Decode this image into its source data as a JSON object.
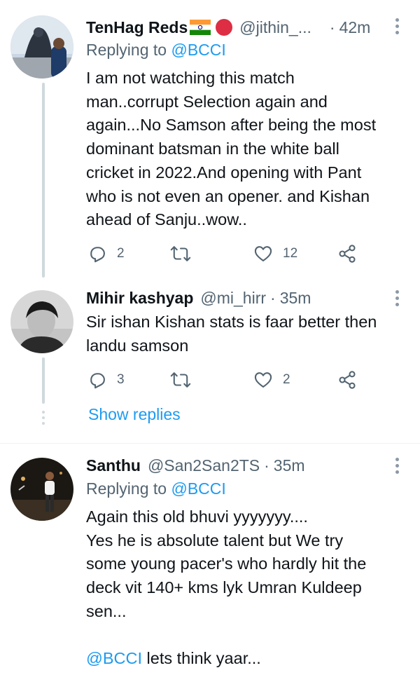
{
  "tweets": [
    {
      "name": "TenHag Reds",
      "handle": "@jithin_...",
      "separator": "·",
      "time": "42m",
      "replying_label": "Replying to",
      "replying_to": "@BCCI",
      "text_lines": [
        "I am not watching this match",
        "man..corrupt Selection again and",
        "again...No Samson after being the most",
        "dominant batsman in the white ball",
        "cricket in 2022.And opening with Pant",
        "who is not even an opener. and Kishan",
        "ahead of Sanju..wow.."
      ],
      "replies": "2",
      "retweets": "",
      "likes": "12",
      "emoji_icons": [
        "india-flag-icon",
        "red-circle-icon"
      ]
    },
    {
      "name": "Mihir kashyap",
      "handle": "@mi_hirr",
      "separator": "·",
      "time": "35m",
      "text_lines": [
        "Sir ishan Kishan stats is faar better then",
        "landu samson"
      ],
      "replies": "3",
      "retweets": "",
      "likes": "2"
    },
    {
      "name": "Santhu",
      "handle": "@San2San2TS",
      "separator": "·",
      "time": "35m",
      "replying_label": "Replying to",
      "replying_to": "@BCCI",
      "text_lines": [
        "Again this old bhuvi yyyyyyy....",
        "Yes he is absolute talent but We try",
        "some young pacer's who hardly hit the",
        "deck vit 140+ kms lyk Umran Kuldeep",
        "sen..."
      ],
      "text_last_mention": "@BCCI",
      "text_last_after": " lets think yaar..."
    }
  ],
  "show_replies": "Show replies",
  "colors": {
    "accent": "#1d9bf0",
    "secondary_text": "#536471",
    "thread_line": "#cfd9de",
    "divider": "#eff3f4"
  }
}
